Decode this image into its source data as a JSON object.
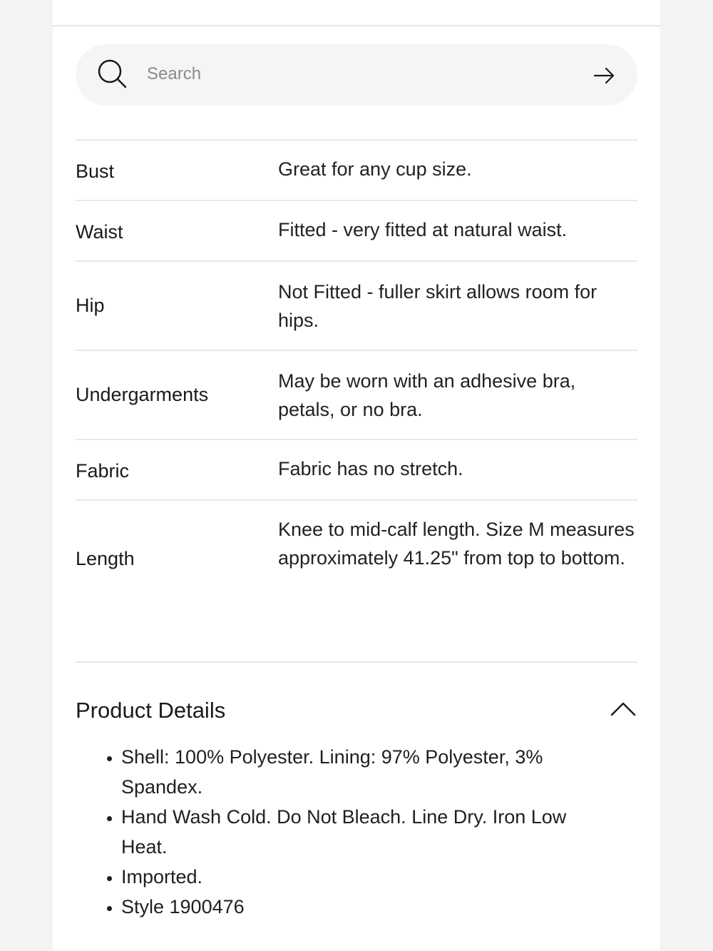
{
  "search": {
    "placeholder": "Search",
    "value": ""
  },
  "fit_table": {
    "rows": [
      {
        "label": "Bust",
        "value": "Great for any cup size."
      },
      {
        "label": "Waist",
        "value": "Fitted - very fitted at natural waist."
      },
      {
        "label": "Hip",
        "value": "Not Fitted - fuller skirt allows room for hips."
      },
      {
        "label": "Undergarments",
        "value": "May be worn with an adhesive bra, petals, or no bra."
      },
      {
        "label": "Fabric",
        "value": "Fabric has no stretch."
      },
      {
        "label": "Length",
        "value": "Knee to mid-calf length. Size M measures approximately 41.25\" from top to bottom."
      }
    ]
  },
  "product_details": {
    "title": "Product Details",
    "expanded": true,
    "items": [
      "Shell: 100% Polyester. Lining: 97% Polyester, 3% Spandex.",
      "Hand Wash Cold. Do Not Bleach. Line Dry. Iron Low Heat.",
      "Imported.",
      "Style 1900476"
    ]
  },
  "colors": {
    "page_bg": "#ffffff",
    "outer_bg": "#f3f3f3",
    "search_bg": "#f5f5f5",
    "divider": "#e8e8e8",
    "text": "#1f1f1f",
    "placeholder": "#8a8a8a"
  },
  "icons": {
    "search": "search-icon",
    "submit": "arrow-right-icon",
    "collapse": "chevron-up-icon"
  }
}
